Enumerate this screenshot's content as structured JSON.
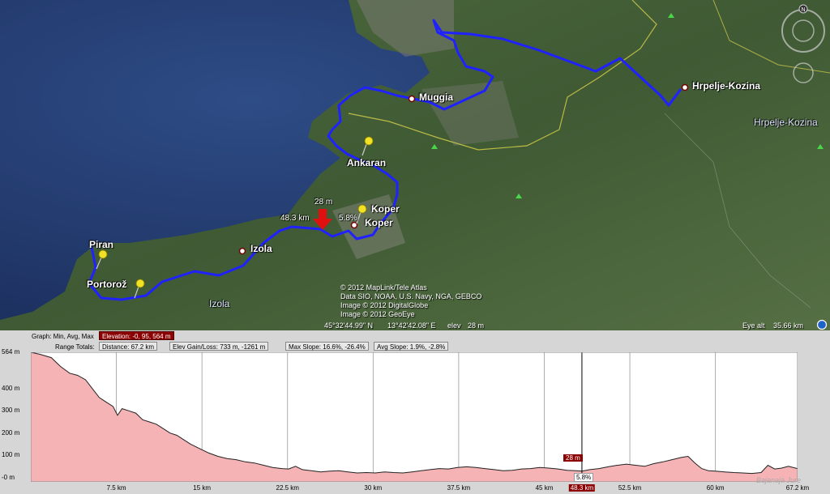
{
  "map": {
    "places": {
      "muggia": "Muggia",
      "hrpelje1": "Hrpelje-Kozina",
      "hrpelje2": "Hrpelje-Kozina",
      "ankaran": "Ankaran",
      "koper1": "Koper",
      "koper2": "Koper",
      "izola1": "Izola",
      "izola2": "Izola",
      "piran": "Piran",
      "portoroz": "Portorož"
    },
    "marker": {
      "elevation": "28 m",
      "distance": "48.3 km",
      "slope": "5.8%"
    },
    "credits": [
      "© 2012 MapLink/Tele Atlas",
      "Data SIO, NOAA, U.S. Navy, NGA, GEBCO",
      "Image © 2012 DigitalGlobe",
      "Image © 2012 GeoEye"
    ],
    "coords": {
      "lat": "45°32'44.99\" N",
      "lon": "13°42'42.08\" E",
      "elev_label": "elev",
      "elev_value": "28 m"
    },
    "eye_alt": {
      "label": "Eye alt",
      "value": "35.66 km"
    },
    "compass_label": "N"
  },
  "panel": {
    "graph_label": "Graph: Min, Avg, Max",
    "elevation_box": "Elevation: -0, 95, 564 m",
    "range_label": "Range Totals:",
    "distance_box": "Distance: 67.2 km",
    "elev_gain_box": "Elev Gain/Loss: 733 m, -1261 m",
    "max_slope_box": "Max Slope: 16.6%, -26.4%",
    "avg_slope_box": "Avg Slope: 1.9%, -2.8%",
    "watermark": "Bajanaja Jure"
  },
  "chart_data": {
    "type": "area",
    "x_unit": "km",
    "y_unit": "m",
    "xlim": [
      0,
      67.2
    ],
    "ylim": [
      -20,
      564
    ],
    "y_ticks": [
      "564 m",
      "400 m",
      "300 m",
      "200 m",
      "100 m",
      "-0 m"
    ],
    "y_tick_values": [
      564,
      400,
      300,
      200,
      100,
      0
    ],
    "x_ticks": [
      "7.5 km",
      "15 km",
      "22.5 km",
      "30 km",
      "37.5 km",
      "45 km",
      "48.3 km",
      "52.5 km",
      "60 km",
      "67.2 km"
    ],
    "x_tick_values": [
      7.5,
      15,
      22.5,
      30,
      37.5,
      45,
      48.3,
      52.5,
      60,
      67.2
    ],
    "cursor": {
      "x": 48.3,
      "elevation": "28 m",
      "slope": "5.8%"
    },
    "x": [
      0,
      0.8,
      1.8,
      2.6,
      3.4,
      4.1,
      4.8,
      5.4,
      6.0,
      6.6,
      7.2,
      7.6,
      8.0,
      8.6,
      9.2,
      9.8,
      10.4,
      11.0,
      11.6,
      12.2,
      12.8,
      13.4,
      14.0,
      14.8,
      15.6,
      16.4,
      17.2,
      18.0,
      18.8,
      19.6,
      20.4,
      21.2,
      22.0,
      22.6,
      23.2,
      23.8,
      24.6,
      25.4,
      26.2,
      27.0,
      27.8,
      28.6,
      29.4,
      30.2,
      31.0,
      31.8,
      32.6,
      33.4,
      34.2,
      35.0,
      35.8,
      36.6,
      37.4,
      38.2,
      39.0,
      39.8,
      40.6,
      41.4,
      42.2,
      43.0,
      43.8,
      44.6,
      45.4,
      46.2,
      47.0,
      47.8,
      48.3,
      49.0,
      49.8,
      50.6,
      51.4,
      52.2,
      53.0,
      53.8,
      54.6,
      55.4,
      56.2,
      57.0,
      57.6,
      58.2,
      58.8,
      59.4,
      60.0,
      60.8,
      61.6,
      62.4,
      63.2,
      64.0,
      64.6,
      65.2,
      65.8,
      66.4,
      67.2
    ],
    "y": [
      564,
      555,
      540,
      500,
      470,
      460,
      440,
      400,
      360,
      340,
      320,
      280,
      310,
      300,
      290,
      260,
      250,
      240,
      220,
      200,
      190,
      170,
      150,
      130,
      110,
      95,
      85,
      80,
      70,
      65,
      55,
      45,
      40,
      38,
      50,
      35,
      30,
      25,
      28,
      30,
      25,
      20,
      22,
      20,
      25,
      22,
      20,
      25,
      30,
      35,
      40,
      38,
      45,
      48,
      45,
      40,
      35,
      30,
      32,
      38,
      40,
      45,
      42,
      38,
      32,
      30,
      28,
      35,
      40,
      48,
      55,
      60,
      55,
      50,
      62,
      70,
      80,
      90,
      95,
      65,
      40,
      30,
      28,
      25,
      22,
      20,
      18,
      22,
      55,
      38,
      42,
      50,
      40
    ]
  }
}
